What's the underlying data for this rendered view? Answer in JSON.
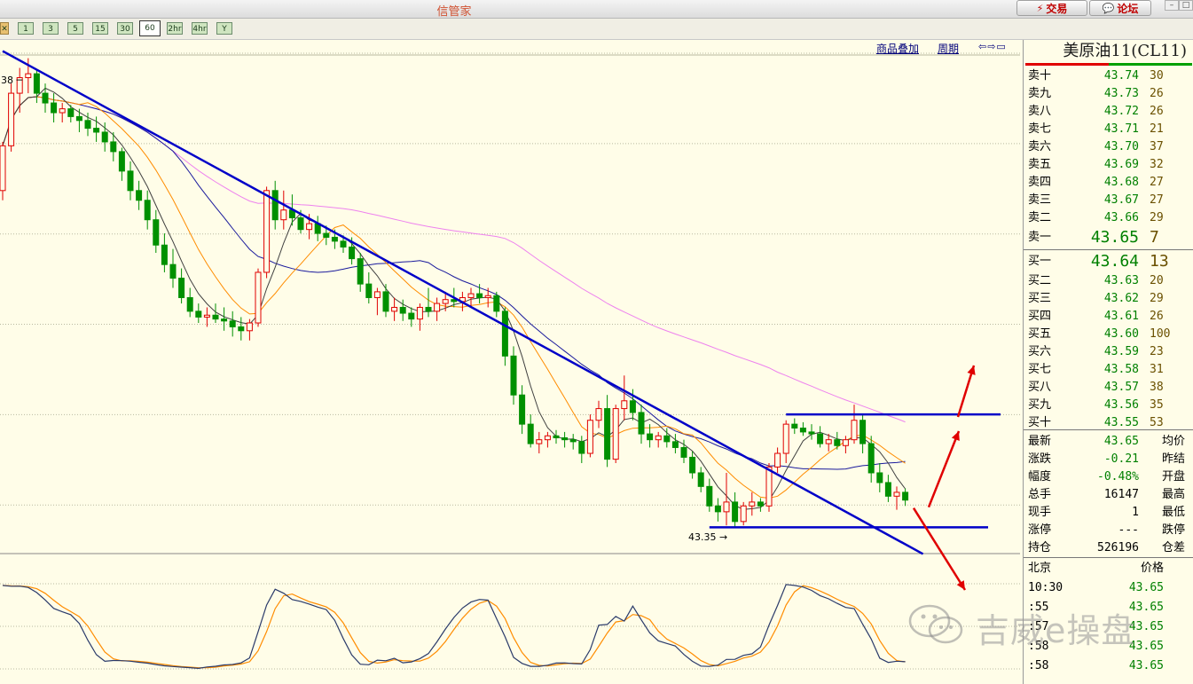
{
  "app": {
    "title": "信管家"
  },
  "titlebar": {
    "trade_label": "交易",
    "forum_label": "论坛"
  },
  "toolbar": {
    "periods": [
      "1",
      "3",
      "5",
      "15",
      "30",
      "60",
      "2hr",
      "4hr",
      "Y"
    ],
    "active_period": "60"
  },
  "chart_links": {
    "overlay": "商品叠加",
    "period": "周期"
  },
  "chart_data": {
    "type": "candlestick",
    "instrument": "美原油11(CL11)",
    "price_labels": {
      "high_marker": "38",
      "low_marker": "43.35"
    },
    "candles": [
      [
        43.7,
        43.95,
        43.65,
        43.93
      ],
      [
        43.93,
        44.25,
        43.9,
        44.2
      ],
      [
        44.2,
        44.33,
        44.1,
        44.28
      ],
      [
        44.28,
        44.38,
        44.2,
        44.3
      ],
      [
        44.3,
        44.32,
        44.15,
        44.2
      ],
      [
        44.2,
        44.25,
        44.1,
        44.15
      ],
      [
        44.15,
        44.2,
        44.05,
        44.1
      ],
      [
        44.1,
        44.15,
        44.05,
        44.12
      ],
      [
        44.12,
        44.14,
        44.05,
        44.08
      ],
      [
        44.08,
        44.12,
        44.0,
        44.06
      ],
      [
        44.06,
        44.1,
        43.98,
        44.02
      ],
      [
        44.02,
        44.08,
        43.95,
        44.0
      ],
      [
        44.0,
        44.05,
        43.9,
        43.95
      ],
      [
        43.95,
        44.0,
        43.85,
        43.9
      ],
      [
        43.9,
        43.92,
        43.75,
        43.8
      ],
      [
        43.8,
        43.85,
        43.65,
        43.7
      ],
      [
        43.7,
        43.75,
        43.6,
        43.65
      ],
      [
        43.65,
        43.7,
        43.5,
        43.55
      ],
      [
        43.55,
        43.6,
        43.38,
        43.42
      ],
      [
        43.42,
        43.48,
        43.28,
        43.32
      ],
      [
        43.32,
        43.4,
        43.2,
        43.25
      ],
      [
        43.25,
        43.3,
        43.12,
        43.15
      ],
      [
        43.15,
        43.2,
        43.05,
        43.08
      ],
      [
        43.08,
        43.12,
        43.02,
        43.05
      ],
      [
        43.05,
        43.1,
        43.0,
        43.06
      ],
      [
        43.06,
        43.12,
        43.02,
        43.04
      ],
      [
        43.04,
        43.1,
        42.98,
        43.03
      ],
      [
        43.03,
        43.08,
        42.95,
        43.0
      ],
      [
        43.0,
        43.05,
        42.93,
        42.98
      ],
      [
        42.98,
        43.04,
        42.93,
        43.02
      ],
      [
        43.02,
        43.3,
        43.0,
        43.28
      ],
      [
        43.28,
        43.72,
        43.25,
        43.7
      ],
      [
        43.7,
        43.75,
        43.5,
        43.55
      ],
      [
        43.55,
        43.7,
        43.5,
        43.6
      ],
      [
        43.6,
        43.68,
        43.52,
        43.56
      ],
      [
        43.56,
        43.6,
        43.48,
        43.5
      ],
      [
        43.5,
        43.58,
        43.45,
        43.53
      ],
      [
        43.53,
        43.57,
        43.44,
        43.48
      ],
      [
        43.48,
        43.52,
        43.42,
        43.46
      ],
      [
        43.46,
        43.5,
        43.4,
        43.44
      ],
      [
        43.44,
        43.47,
        43.38,
        43.41
      ],
      [
        43.41,
        43.46,
        43.32,
        43.35
      ],
      [
        43.35,
        43.38,
        43.18,
        43.22
      ],
      [
        43.22,
        43.28,
        43.12,
        43.15
      ],
      [
        43.15,
        43.2,
        43.06,
        43.18
      ],
      [
        43.18,
        43.22,
        43.05,
        43.08
      ],
      [
        43.08,
        43.15,
        43.03,
        43.1
      ],
      [
        43.1,
        43.14,
        43.03,
        43.07
      ],
      [
        43.07,
        43.1,
        43.0,
        43.04
      ],
      [
        43.04,
        43.12,
        42.98,
        43.1
      ],
      [
        43.1,
        43.2,
        43.05,
        43.08
      ],
      [
        43.08,
        43.15,
        43.03,
        43.12
      ],
      [
        43.12,
        43.18,
        43.08,
        43.14
      ],
      [
        43.14,
        43.2,
        43.1,
        43.13
      ],
      [
        43.13,
        43.18,
        43.08,
        43.15
      ],
      [
        43.15,
        43.2,
        43.1,
        43.17
      ],
      [
        43.17,
        43.22,
        43.12,
        43.15
      ],
      [
        43.15,
        43.2,
        43.1,
        43.16
      ],
      [
        43.16,
        43.18,
        43.05,
        43.08
      ],
      [
        43.08,
        43.1,
        42.8,
        42.85
      ],
      [
        42.85,
        42.9,
        42.6,
        42.65
      ],
      [
        42.65,
        42.7,
        42.45,
        42.5
      ],
      [
        42.5,
        42.55,
        42.38,
        42.4
      ],
      [
        42.4,
        42.46,
        42.35,
        42.42
      ],
      [
        42.42,
        42.46,
        42.38,
        42.44
      ],
      [
        42.44,
        42.47,
        42.4,
        42.43
      ],
      [
        42.43,
        42.46,
        42.38,
        42.42
      ],
      [
        42.42,
        42.45,
        42.37,
        42.41
      ],
      [
        42.41,
        42.44,
        42.3,
        42.35
      ],
      [
        42.35,
        42.55,
        42.33,
        42.52
      ],
      [
        42.52,
        42.62,
        42.48,
        42.58
      ],
      [
        42.58,
        42.65,
        42.28,
        42.32
      ],
      [
        42.32,
        42.6,
        42.3,
        42.58
      ],
      [
        42.58,
        42.75,
        42.52,
        42.62
      ],
      [
        42.62,
        42.68,
        42.52,
        42.56
      ],
      [
        42.56,
        42.6,
        42.4,
        42.45
      ],
      [
        42.45,
        42.5,
        42.38,
        42.42
      ],
      [
        42.42,
        42.46,
        42.38,
        42.44
      ],
      [
        42.44,
        42.48,
        42.38,
        42.41
      ],
      [
        42.41,
        42.45,
        42.35,
        42.38
      ],
      [
        42.38,
        42.42,
        42.3,
        42.33
      ],
      [
        42.33,
        42.36,
        42.22,
        42.25
      ],
      [
        42.25,
        42.28,
        42.15,
        42.18
      ],
      [
        42.18,
        42.22,
        42.05,
        42.08
      ],
      [
        42.08,
        42.12,
        42.0,
        42.05
      ],
      [
        42.05,
        42.25,
        41.98,
        42.1
      ],
      [
        42.1,
        42.15,
        41.97,
        42.0
      ],
      [
        42.0,
        42.1,
        41.98,
        42.08
      ],
      [
        42.08,
        42.15,
        42.03,
        42.1
      ],
      [
        42.1,
        42.12,
        42.05,
        42.08
      ],
      [
        42.08,
        42.3,
        42.05,
        42.28
      ],
      [
        42.28,
        42.38,
        42.25,
        42.35
      ],
      [
        42.35,
        42.52,
        42.3,
        42.5
      ],
      [
        42.5,
        42.53,
        42.45,
        42.48
      ],
      [
        42.48,
        42.51,
        42.44,
        42.46
      ],
      [
        42.46,
        42.5,
        42.42,
        42.45
      ],
      [
        42.45,
        42.49,
        42.38,
        42.4
      ],
      [
        42.4,
        42.45,
        42.36,
        42.42
      ],
      [
        42.42,
        42.46,
        42.37,
        42.39
      ],
      [
        42.39,
        42.44,
        42.35,
        42.42
      ],
      [
        42.42,
        42.6,
        42.4,
        42.52
      ],
      [
        42.52,
        42.55,
        42.35,
        42.4
      ],
      [
        42.4,
        42.44,
        42.2,
        42.25
      ],
      [
        42.25,
        42.3,
        42.15,
        42.2
      ],
      [
        42.2,
        42.24,
        42.1,
        42.13
      ],
      [
        42.13,
        42.18,
        42.06,
        42.15
      ],
      [
        42.15,
        42.17,
        42.08,
        42.11
      ]
    ],
    "oscillator": {
      "upper_level": 80,
      "lower_level": 20
    },
    "annotations": [
      "descending-trendline",
      "horizontal-channel",
      "breakout-arrows"
    ]
  },
  "quote": {
    "symbol": "美原油11(CL11)",
    "ask": [
      {
        "label": "卖十",
        "price": "43.74",
        "vol": "30"
      },
      {
        "label": "卖九",
        "price": "43.73",
        "vol": "26"
      },
      {
        "label": "卖八",
        "price": "43.72",
        "vol": "26"
      },
      {
        "label": "卖七",
        "price": "43.71",
        "vol": "21"
      },
      {
        "label": "卖六",
        "price": "43.70",
        "vol": "37"
      },
      {
        "label": "卖五",
        "price": "43.69",
        "vol": "32"
      },
      {
        "label": "卖四",
        "price": "43.68",
        "vol": "27"
      },
      {
        "label": "卖三",
        "price": "43.67",
        "vol": "27"
      },
      {
        "label": "卖二",
        "price": "43.66",
        "vol": "29"
      },
      {
        "label": "卖一",
        "price": "43.65",
        "vol": "7"
      }
    ],
    "bid": [
      {
        "label": "买一",
        "price": "43.64",
        "vol": "13"
      },
      {
        "label": "买二",
        "price": "43.63",
        "vol": "20"
      },
      {
        "label": "买三",
        "price": "43.62",
        "vol": "29"
      },
      {
        "label": "买四",
        "price": "43.61",
        "vol": "26"
      },
      {
        "label": "买五",
        "price": "43.60",
        "vol": "100"
      },
      {
        "label": "买六",
        "price": "43.59",
        "vol": "23"
      },
      {
        "label": "买七",
        "price": "43.58",
        "vol": "31"
      },
      {
        "label": "买八",
        "price": "43.57",
        "vol": "38"
      },
      {
        "label": "买九",
        "price": "43.56",
        "vol": "35"
      },
      {
        "label": "买十",
        "price": "43.55",
        "vol": "53"
      }
    ],
    "stats": [
      {
        "label": "最新",
        "value": "43.65",
        "label2": "均价",
        "color": "#008000"
      },
      {
        "label": "涨跌",
        "value": "-0.21",
        "label2": "昨结",
        "color": "#008000"
      },
      {
        "label": "幅度",
        "value": "-0.48%",
        "label2": "开盘",
        "color": "#008000"
      },
      {
        "label": "总手",
        "value": "16147",
        "label2": "最高",
        "color": "#000000"
      },
      {
        "label": "现手",
        "value": "1",
        "label2": "最低",
        "color": "#000000"
      },
      {
        "label": "涨停",
        "value": "---",
        "label2": "跌停",
        "color": "#000000"
      },
      {
        "label": "持仓",
        "value": "526196",
        "label2": "仓差",
        "color": "#000000"
      }
    ],
    "ticks_header": {
      "left": "北京",
      "right": "价格"
    },
    "ticks": [
      {
        "time": "10:30",
        "price": "43.65"
      },
      {
        "time": ":55",
        "price": "43.65"
      },
      {
        "time": ":57",
        "price": "43.65"
      },
      {
        "time": ":58",
        "price": "43.65"
      },
      {
        "time": ":58",
        "price": "43.65"
      }
    ]
  },
  "watermark": {
    "text": "吉威e操盘"
  },
  "colors": {
    "bull": "#e00000",
    "bear": "#009000",
    "ma1": "#404040",
    "ma2": "#ff8c00",
    "ma3": "#1a1a9c",
    "ma4": "#ee82ee",
    "trendline": "#0000c8",
    "arrow": "#e00000"
  }
}
